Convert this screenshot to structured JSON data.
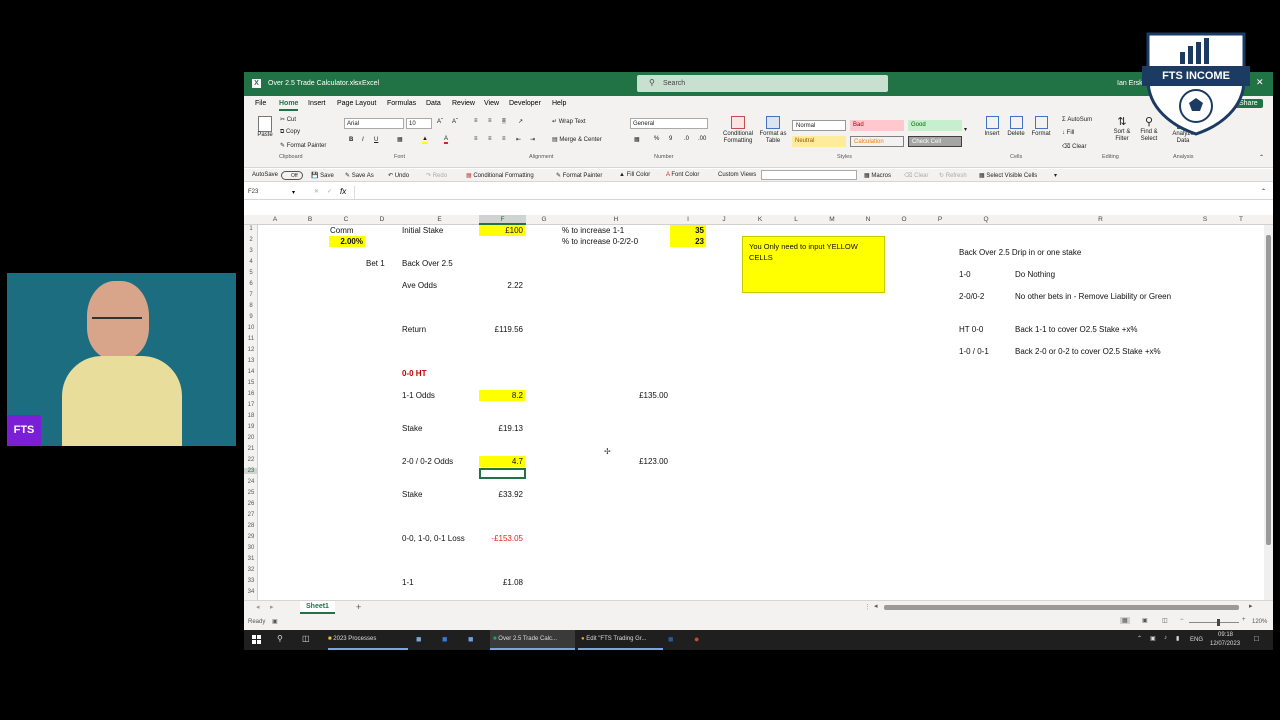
{
  "window": {
    "filename": "Over 2.5 Trade Calculator.xlsx",
    "app": "Excel",
    "search_placeholder": "Search",
    "user": "Ian Erskine"
  },
  "ribbon_tabs": [
    "File",
    "Home",
    "Insert",
    "Page Layout",
    "Formulas",
    "Data",
    "Review",
    "View",
    "Developer",
    "Help"
  ],
  "active_tab": "Home",
  "share_label": "Share",
  "ribbon": {
    "clipboard": {
      "paste": "Paste",
      "cut": "Cut",
      "copy": "Copy",
      "format_painter": "Format Painter",
      "group": "Clipboard"
    },
    "font": {
      "name": "Arial",
      "size": "10",
      "group": "Font"
    },
    "alignment": {
      "wrap": "Wrap Text",
      "merge": "Merge & Center",
      "group": "Alignment"
    },
    "number": {
      "format": "General",
      "group": "Number"
    },
    "styles": {
      "conditional": "Conditional Formatting",
      "format_table": "Format as Table",
      "normal": "Normal",
      "bad": "Bad",
      "good": "Good",
      "neutral": "Neutral",
      "calculation": "Calculation",
      "check_cell": "Check Cell",
      "group": "Styles"
    },
    "cells": {
      "insert": "Insert",
      "delete": "Delete",
      "format": "Format",
      "group": "Cells"
    },
    "editing": {
      "autosum": "AutoSum",
      "fill": "Fill",
      "clear": "Clear",
      "sort": "Sort & Filter",
      "find": "Find & Select",
      "group": "Editing"
    },
    "analysis": {
      "analyze": "Analyze Data",
      "group": "Analysis"
    }
  },
  "qat": {
    "autosave": "AutoSave",
    "autosave_state": "Off",
    "save": "Save",
    "save_as": "Save As",
    "undo": "Undo",
    "redo": "Redo",
    "conditional": "Conditional Formatting",
    "format_painter": "Format Painter",
    "fill_color": "Fill Color",
    "font_color": "Font Color",
    "custom_views": "Custom Views",
    "macros": "Macros",
    "clear": "Clear",
    "refresh": "Refresh",
    "select_visible": "Select Visible Cells"
  },
  "name_box": "F23",
  "columns": [
    "A",
    "B",
    "C",
    "D",
    "E",
    "F",
    "G",
    "H",
    "I",
    "J",
    "K",
    "L",
    "M",
    "N",
    "O",
    "P",
    "Q",
    "R",
    "S",
    "T"
  ],
  "rows": [
    "1",
    "2",
    "3",
    "4",
    "5",
    "6",
    "7",
    "8",
    "9",
    "10",
    "11",
    "12",
    "13",
    "14",
    "15",
    "16",
    "17",
    "18",
    "19",
    "20",
    "21",
    "22",
    "23",
    "24",
    "25",
    "26",
    "27",
    "28",
    "29",
    "30",
    "31",
    "32",
    "33",
    "34"
  ],
  "cells": {
    "c1": "Comm",
    "c2": "2.00%",
    "e1": "Initial Stake",
    "f1": "£100",
    "h1": "% to increase 1-1",
    "i1": "35",
    "h2": "% to increase 0-2/2-0",
    "i2": "23",
    "d4": "Bet 1",
    "e4": "Back Over 2.5",
    "e6": "Ave Odds",
    "f6": "2.22",
    "e10": "Return",
    "f10": "£119.56",
    "e14": "0-0 HT",
    "e16": "1-1 Odds",
    "f16": "8.2",
    "h16": "£135.00",
    "e19": "Stake",
    "f19": "£19.13",
    "e22": "2-0 / 0-2 Odds",
    "f22": "4.7",
    "h22": "£123.00",
    "e25": "Stake",
    "f25": "£33.92",
    "e29": "0-0, 1-0, 0-1 Loss",
    "f29": "-£153.05",
    "e33": "1-1",
    "f33": "£1.08"
  },
  "note": "You Only need to input YELLOW CELLS",
  "instructions": [
    {
      "q": "Back Over 2.5 Drip in or one stake",
      "r": ""
    },
    {
      "q": "1-0",
      "r": "Do Nothing"
    },
    {
      "q": "2-0/0-2",
      "r": "No other bets in - Remove Liability or Green"
    },
    {
      "q": "HT 0-0",
      "r": "Back 1-1 to cover O2.5 Stake +x%"
    },
    {
      "q": "1-0 / 0-1",
      "r": "Back 2-0 or 0-2 to cover O2.5 Stake +x%"
    }
  ],
  "sheet_tab": "Sheet1",
  "status": "Ready",
  "zoom": "120%",
  "taskbar": {
    "items": [
      "2023 Processes",
      "Over 2.5 Trade Calc...",
      "Edit \"FTS Trading Gr..."
    ],
    "lang": "ENG",
    "time": "09:18",
    "date": "12/07/2023"
  },
  "overlay": {
    "logo_text": "FTS INCOME",
    "webcam_badge": "FTS"
  },
  "colors": {
    "excel_green": "#217346",
    "yellow": "#ffff00",
    "negative": "#e02020",
    "ht_red": "#c00000",
    "badge_purple": "#7b1fd6"
  }
}
